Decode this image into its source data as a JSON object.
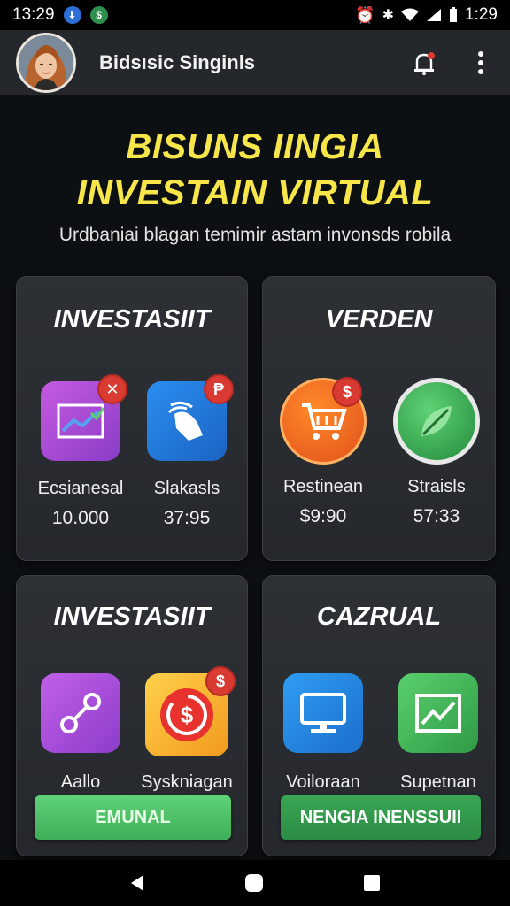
{
  "status_bar": {
    "time_left": "13:29",
    "time_right": "1:29"
  },
  "app_bar": {
    "title": "Bidsısic Singinls",
    "icons": [
      "avatar",
      "notification-bell-icon",
      "more-vert-icon"
    ]
  },
  "headline": {
    "line1": "BISUNS IINGIA",
    "line2": "INVESTAIN VIRTUAL"
  },
  "subtitle": "Urdbaniai blagan temimir astam invonsds robila",
  "cards": [
    {
      "title": "INVESTASIIT",
      "tiles": [
        {
          "label": "Ecsianesal",
          "value": "10.000",
          "icon": "chart-line-icon"
        },
        {
          "label": "Slakasls",
          "value": "37:95",
          "icon": "hand-swipe-icon"
        }
      ]
    },
    {
      "title": "VERDEN",
      "tiles": [
        {
          "label": "Restinean",
          "value": "$9:90",
          "icon": "shopping-cart-icon"
        },
        {
          "label": "Straisls",
          "value": "57:33",
          "icon": "leaf-icon"
        }
      ]
    },
    {
      "title": "INVESTASIIT",
      "tiles": [
        {
          "label": "Aallo",
          "icon": "share-link-icon"
        },
        {
          "label": "Syskniagan",
          "icon": "dollar-refresh-icon"
        }
      ],
      "button": "EMUNAL"
    },
    {
      "title": "CAZRUAL",
      "tiles": [
        {
          "label": "Voiloraan",
          "icon": "monitor-icon"
        },
        {
          "label": "Supetnan",
          "icon": "trend-chart-icon"
        }
      ],
      "button": "NENGIA INENSSUII"
    }
  ],
  "colors": {
    "headline": "#f7e64a",
    "button_green": "#4cc063",
    "button_dark_green": "#2f9a4a",
    "badge_red": "#d93a32"
  }
}
